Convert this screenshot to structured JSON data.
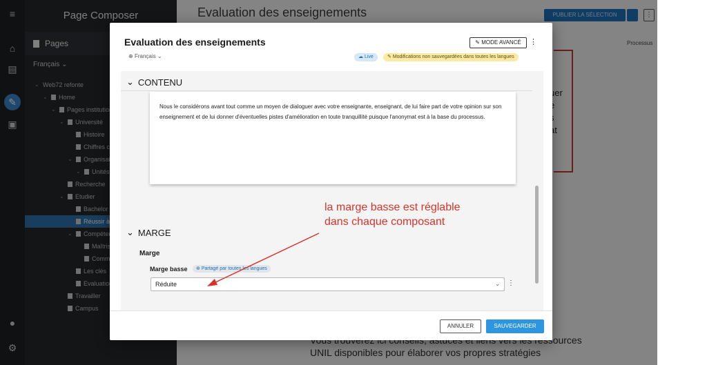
{
  "app": {
    "title": "Page Composer"
  },
  "sidebar": {
    "pages_label": "Pages",
    "language": "Français",
    "tree": [
      {
        "label": "Web72 refonte",
        "level": 0,
        "chevron": true,
        "doc": false
      },
      {
        "label": "Home",
        "level": 1,
        "chevron": true,
        "doc": true
      },
      {
        "label": "Pages institutionnelles",
        "level": 2,
        "chevron": true,
        "doc": true
      },
      {
        "label": "Université",
        "level": 3,
        "chevron": true,
        "doc": true
      },
      {
        "label": "Histoire",
        "level": 4,
        "chevron": false,
        "doc": true
      },
      {
        "label": "Chiffres clés",
        "level": 4,
        "chevron": false,
        "doc": true
      },
      {
        "label": "Organisation",
        "level": 4,
        "chevron": true,
        "doc": true
      },
      {
        "label": "Unités",
        "level": 5,
        "chevron": true,
        "doc": true
      },
      {
        "label": "Recherche",
        "level": 3,
        "chevron": false,
        "doc": true
      },
      {
        "label": "Etudier",
        "level": 3,
        "chevron": true,
        "doc": true
      },
      {
        "label": "Bachelor",
        "level": 4,
        "chevron": false,
        "doc": true
      },
      {
        "label": "Réussir à l'UNIL",
        "level": 4,
        "chevron": false,
        "doc": true,
        "selected": true
      },
      {
        "label": "Compétences",
        "level": 4,
        "chevron": true,
        "doc": true
      },
      {
        "label": "Maîtriser",
        "level": 5,
        "chevron": false,
        "doc": true
      },
      {
        "label": "Communiquer",
        "level": 5,
        "chevron": false,
        "doc": true
      },
      {
        "label": "Les clés",
        "level": 4,
        "chevron": false,
        "doc": true
      },
      {
        "label": "Evaluation",
        "level": 4,
        "chevron": false,
        "doc": true
      },
      {
        "label": "Travailler",
        "level": 3,
        "chevron": false,
        "doc": true
      },
      {
        "label": "Campus",
        "level": 3,
        "chevron": false,
        "doc": true
      }
    ]
  },
  "background": {
    "page_title": "Evaluation des enseignements",
    "publish_label": "PUBLIER LA SÉLECTION",
    "tab_label": "Processus",
    "right_words": [
      "uer",
      "e",
      "s",
      "at"
    ],
    "bottom_text_1": "Vous trouverez ici conseils, astuces et liens vers les ressources",
    "bottom_text_2": "UNIL disponibles pour élaborer vos propres stratégies"
  },
  "modal": {
    "title": "Evaluation des enseignements",
    "language": "Français",
    "advanced_label": "MODE AVANCÉ",
    "badge_live": "Live",
    "badge_unsaved": "Modifications non sauvegardées dans toutes les langues",
    "section_content": "CONTENU",
    "content_text": "Nous le considérons avant tout comme un moyen de dialoguer avec votre enseignante, enseignant, de lui faire part de votre opinion sur son enseignement et de lui donner d'éventuelles pistes d'amélioration en toute tranquillité puisque l'anonymat est à la base du processus.",
    "section_marge": "MARGE",
    "marge_label": "Marge",
    "marge_basse_label": "Marge basse",
    "shared_badge": "Partagé par toutes les langues",
    "select_value": "Réduite",
    "cancel_label": "ANNULER",
    "save_label": "SAUVEGARDER"
  },
  "annotation": {
    "line1": "la marge basse est réglable",
    "line2": "dans chaque composant",
    "color": "#d7332a"
  },
  "colors": {
    "accent": "#2e95e0",
    "sidebar_bg": "#24272a",
    "selected_bg": "#2f6fa8"
  }
}
